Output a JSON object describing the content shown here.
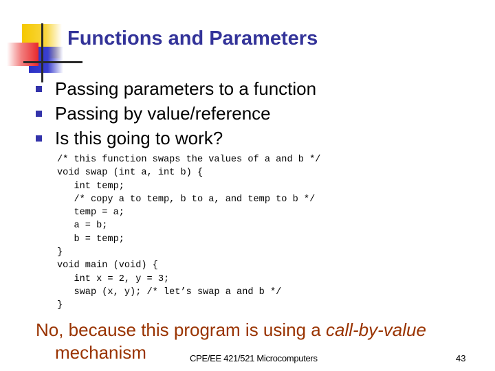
{
  "slide": {
    "title": "Functions and Parameters",
    "bullets": [
      "Passing parameters to a function",
      "Passing by value/reference",
      "Is this going to work?"
    ],
    "code": [
      "/* this function swaps the values of a and b */",
      "void swap (int a, int b) {",
      "   int temp;",
      "   /* copy a to temp, b to a, and temp to b */",
      "   temp = a;",
      "   a = b;",
      "   b = temp;",
      "}",
      "void main (void) {",
      "   int x = 2, y = 3;",
      "   swap (x, y); /* let’s swap a and b */",
      "}"
    ],
    "answer": {
      "prefix": "No, because this program is using a ",
      "emphasis": "call-by-value",
      "suffix": "mechanism"
    },
    "footer": "CPE/EE 421/521 Microcomputers",
    "page_number": "43",
    "colors": {
      "title": "#333399",
      "bullet": "#3333aa",
      "answer": "#993300"
    }
  }
}
